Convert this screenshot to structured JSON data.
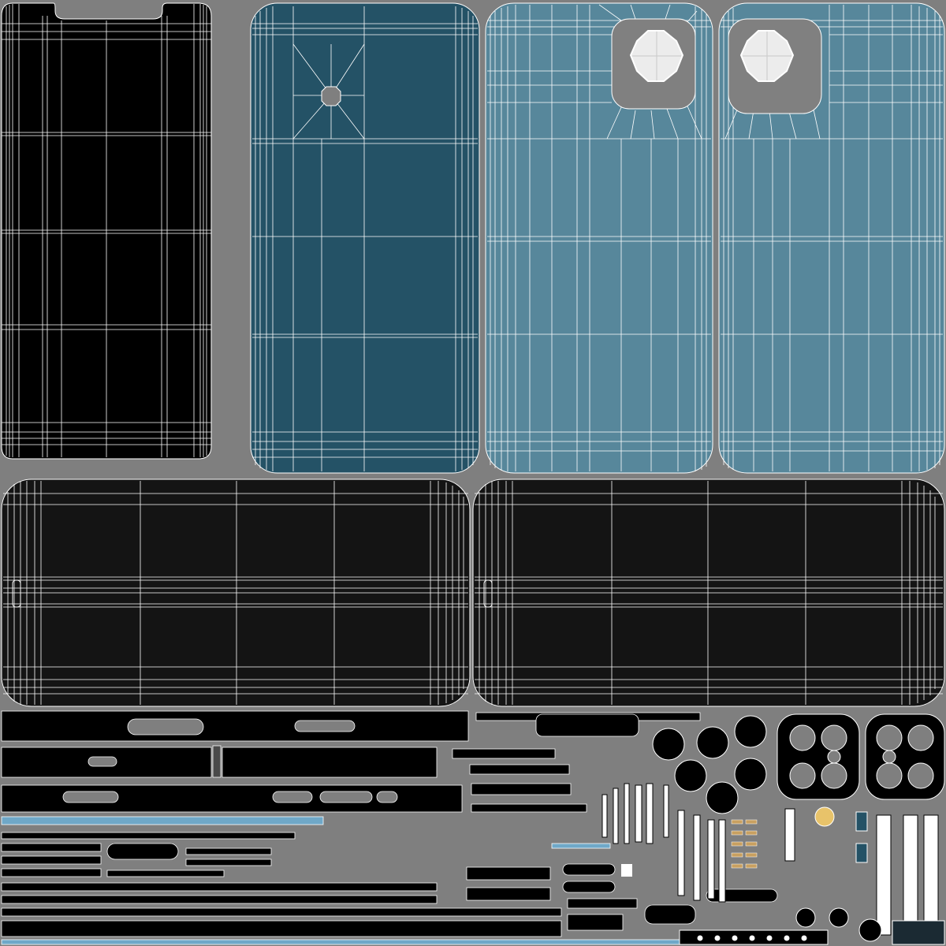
{
  "atlas": {
    "background": "#7f7f7f",
    "wire_color": "#ffffff",
    "fills": {
      "screen": "#000000",
      "back_dark_blue": "#245266",
      "back_light_blue": "#57879b",
      "camera_module": "#808080",
      "frame": "#141414",
      "strip": "#000000",
      "trim_accent": "#6fa8c8",
      "flash": "#e8c36a"
    },
    "islands": [
      {
        "name": "uv-screen-front",
        "icon": "phone-front-shell",
        "fill": "screen",
        "notch": true
      },
      {
        "name": "uv-back-dark",
        "icon": "phone-back-shell",
        "fill": "back_dark_blue",
        "camera_hole": true
      },
      {
        "name": "uv-back-light-a",
        "icon": "phone-back-shell",
        "fill": "back_light_blue",
        "camera_module": true
      },
      {
        "name": "uv-back-light-b",
        "icon": "phone-back-shell",
        "fill": "back_light_blue",
        "camera_module": true
      },
      {
        "name": "uv-frame-left",
        "icon": "side-frame",
        "fill": "frame"
      },
      {
        "name": "uv-frame-right",
        "icon": "side-frame",
        "fill": "frame"
      },
      {
        "name": "uv-small-parts",
        "icon": "detail-parts",
        "fill": "strip"
      }
    ]
  }
}
